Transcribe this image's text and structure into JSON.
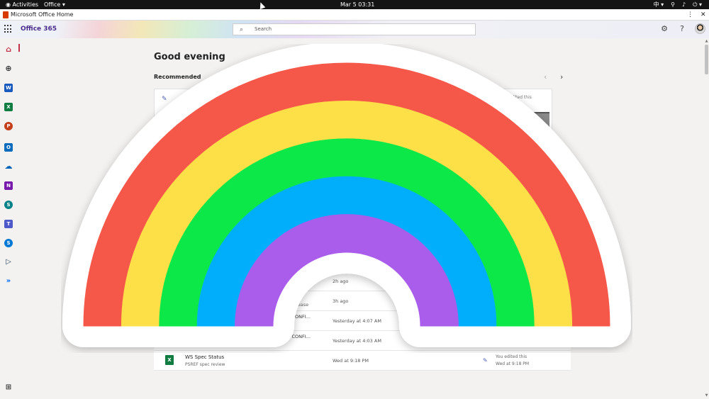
{
  "topbar": {
    "activities": "Activities",
    "app_menu": "Office ▾",
    "clock": "Mar 5  03:31",
    "input_method": "中 ▾",
    "status_icons": [
      "network-icon",
      "volume-icon",
      "power-icon"
    ]
  },
  "window": {
    "title": "Microsoft Office Home",
    "menu_glyph": "⋮",
    "close_glyph": "✕"
  },
  "header": {
    "brand": "Office 365",
    "search_placeholder": "Search",
    "settings_glyph": "⚙",
    "help_glyph": "?"
  },
  "rail": {
    "items": [
      {
        "name": "home",
        "color": "#c4314b"
      },
      {
        "name": "create",
        "color": "#444444"
      },
      {
        "name": "word",
        "color": "#185abd"
      },
      {
        "name": "excel",
        "color": "#107c41"
      },
      {
        "name": "powerpoint",
        "color": "#c43e1c"
      },
      {
        "name": "outlook",
        "color": "#0f6cbd"
      },
      {
        "name": "onedrive",
        "color": "#0364b8"
      },
      {
        "name": "onenote",
        "color": "#7719aa"
      },
      {
        "name": "sharepoint",
        "color": "#038387"
      },
      {
        "name": "teams",
        "color": "#5059c9"
      },
      {
        "name": "sway",
        "color": "#0078d4"
      },
      {
        "name": "stream",
        "color": "#1b3a57"
      },
      {
        "name": "power-automate",
        "color": "#0066ff"
      }
    ]
  },
  "main": {
    "greeting": "Good evening",
    "recommended_title": "Recommended",
    "rec_card_meta": "edited this",
    "files": [
      {
        "time": "2h ago",
        "name_frag": "",
        "sub_frag": ""
      },
      {
        "time": "3h ago",
        "name_frag": "",
        "sub_frag": "ion, Please"
      },
      {
        "time": "Yesterday at 4:07 AM",
        "name_frag": "VO CONFI...",
        "sub_frag": ""
      },
      {
        "time": "Yesterday at 4:03 AM",
        "name_frag": "VO CONFI...",
        "sub_frag": ""
      },
      {
        "time": "Wed at 9:18 PM",
        "name": "WS Spec Status",
        "sub": "PSREF spec review",
        "edited": "You edited this",
        "edited_time": "Wed at 9:18 PM"
      }
    ]
  },
  "rainbow": {
    "band_colors": [
      "#f5594a",
      "#fde047",
      "#11e84a",
      "#00aefc",
      "#a95dea"
    ],
    "outline_color": "#ffffff"
  }
}
